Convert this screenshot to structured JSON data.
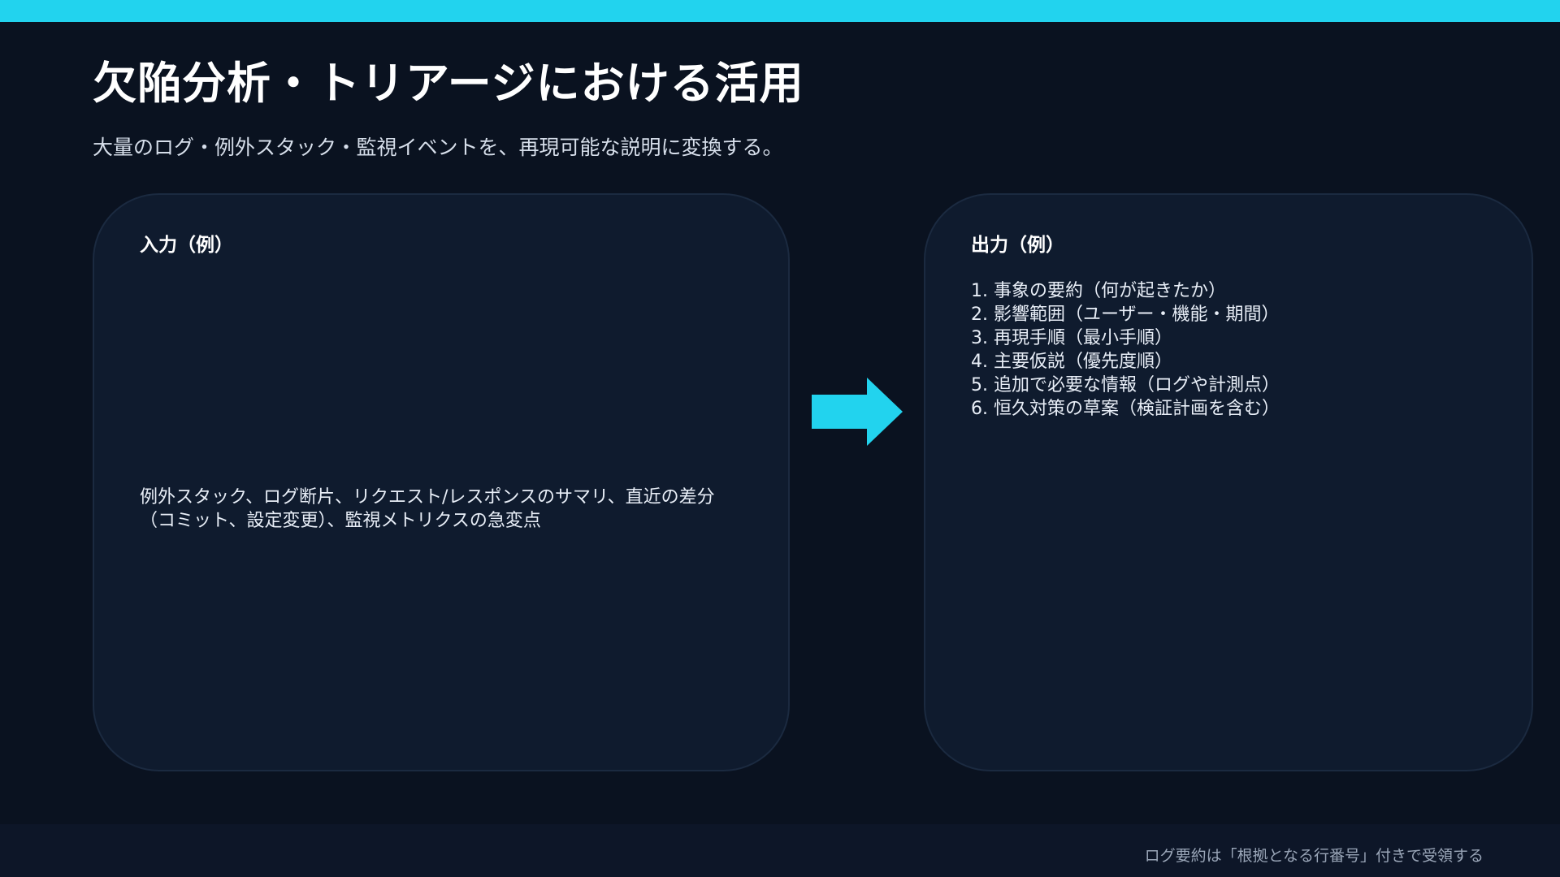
{
  "slide": {
    "title": "欠陥分析・トリアージにおける活用",
    "subtitle": "大量のログ・例外スタック・監視イベントを、再現可能な説明に変換する。"
  },
  "input_panel": {
    "heading": "入力（例）",
    "text": "例外スタック、ログ断片、リクエスト/レスポンスのサマリ、直近の差分（コミット、設定変更）、監視メトリクスの急変点"
  },
  "output_panel": {
    "heading": "出力（例）",
    "items": [
      "1. 事象の要約（何が起きたか）",
      "2. 影響範囲（ユーザー・機能・期間）",
      "3. 再現手順（最小手順）",
      "4. 主要仮説（優先度順）",
      "5. 追加で必要な情報（ログや計測点）",
      "6. 恒久対策の草案（検証計画を含む）"
    ]
  },
  "footer": {
    "note": "ログ要約は「根拠となる行番号」付きで受領する"
  },
  "colors": {
    "accent": "#22d3ee",
    "background": "#0a1220",
    "panel": "#0f1b2e"
  },
  "icons": {
    "arrow": "arrow-right-icon"
  }
}
